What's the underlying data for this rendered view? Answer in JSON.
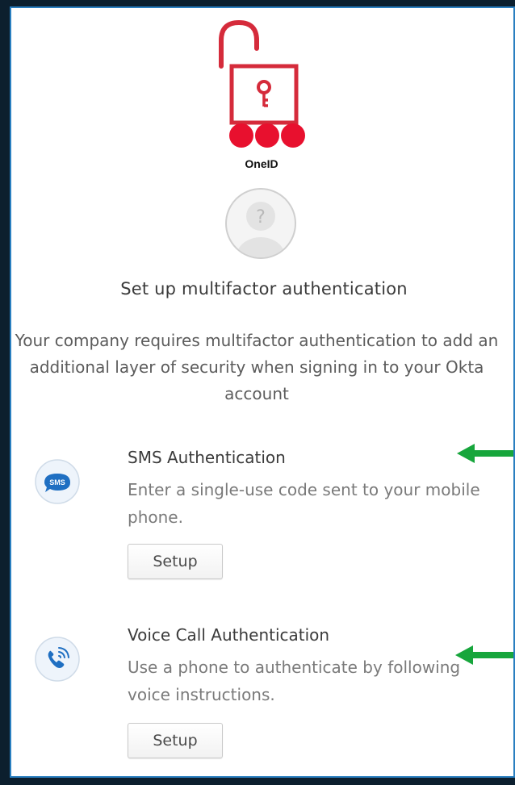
{
  "brand": {
    "name": "OneID",
    "accent_color": "#d52b3b"
  },
  "heading": "Set up multifactor authentication",
  "description": "Your company requires multifactor authentication to add an additional layer of security when signing in to your Okta account",
  "factors": [
    {
      "icon": "sms-icon",
      "icon_label": "SMS",
      "title": "SMS Authentication",
      "description": "Enter a single-use code sent to your mobile phone.",
      "button_label": "Setup"
    },
    {
      "icon": "voice-call-icon",
      "title": "Voice Call Authentication",
      "description": "Use a phone to authenticate by following voice instructions.",
      "button_label": "Setup"
    }
  ],
  "annotations": {
    "arrow_color": "#17a63c"
  }
}
